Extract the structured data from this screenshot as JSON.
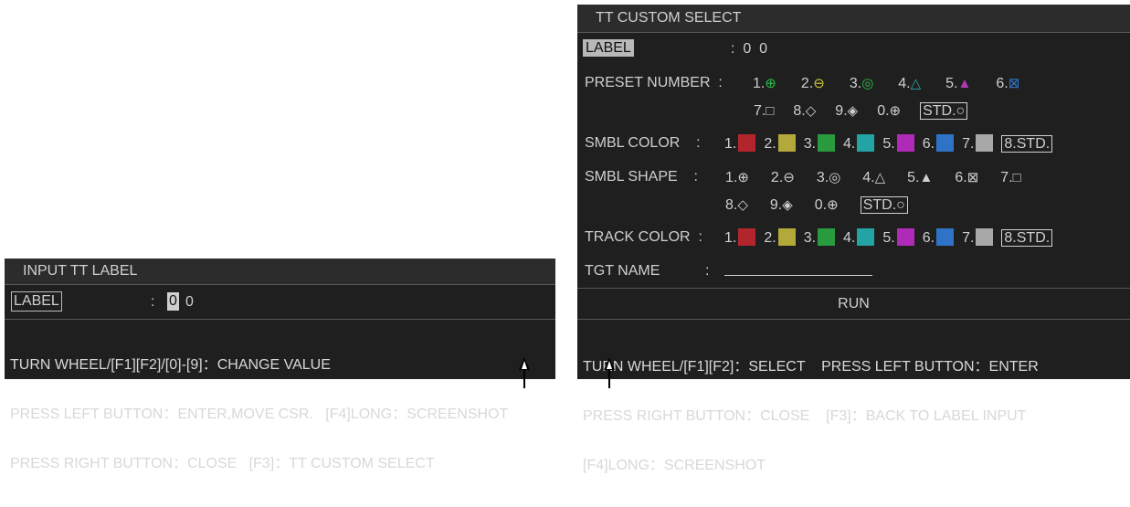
{
  "input_dialog": {
    "title": "INPUT TT LABEL",
    "label_text": "LABEL",
    "colon": ":",
    "digit_cursor": "0",
    "digit_2": "0",
    "help": [
      "TURN WHEEL/[F1][F2]/[0]-[9]：CHANGE VALUE",
      "PRESS LEFT BUTTON：ENTER,MOVE CSR.   [F4]LONG：SCREENSHOT",
      "PRESS RIGHT BUTTON：CLOSE   [F3]：TT CUSTOM SELECT"
    ]
  },
  "custom_dialog": {
    "title": "TT CUSTOM SELECT",
    "label_row": {
      "label": "LABEL",
      "value": ":  0  0"
    },
    "preset_row": {
      "label": "PRESET NUMBER  :",
      "items_line1": [
        {
          "num": "1.",
          "sym": "⊕",
          "color": "#2bbf4a"
        },
        {
          "num": "2.",
          "sym": "⊖",
          "color": "#d1c83a"
        },
        {
          "num": "3.",
          "sym": "◎",
          "color": "#2bbf4a"
        },
        {
          "num": "4.",
          "sym": "△",
          "color": "#2aa6a6"
        },
        {
          "num": "5.",
          "sym": "▲",
          "color": "#b03ab8"
        },
        {
          "num": "6.",
          "sym": "⊠",
          "color": "#2f7ad0"
        }
      ],
      "items_line2": [
        {
          "num": "7.",
          "sym": "□",
          "color": "#cfcfcf"
        },
        {
          "num": "8.",
          "sym": "◇",
          "color": "#cfcfcf"
        },
        {
          "num": "9.",
          "sym": "◈",
          "color": "#cfcfcf"
        },
        {
          "num": "0.",
          "sym": "⊕",
          "color": "#cfcfcf"
        }
      ],
      "std": "STD.○"
    },
    "smbl_color_row": {
      "label": "SMBL COLOR    :",
      "items": [
        {
          "num": "1.",
          "color": "#b3252c"
        },
        {
          "num": "2.",
          "color": "#b3a93a"
        },
        {
          "num": "3.",
          "color": "#2a9a3f"
        },
        {
          "num": "4.",
          "color": "#23a3a3"
        },
        {
          "num": "5.",
          "color": "#b02ab8"
        },
        {
          "num": "6.",
          "color": "#2f73c8"
        },
        {
          "num": "7.",
          "color": "#a8a8a8"
        }
      ],
      "std": "8.STD."
    },
    "smbl_shape_row": {
      "label": "SMBL SHAPE    :",
      "items_line1": [
        {
          "num": "1.",
          "sym": "⊕"
        },
        {
          "num": "2.",
          "sym": "⊖"
        },
        {
          "num": "3.",
          "sym": "◎"
        },
        {
          "num": "4.",
          "sym": "△"
        },
        {
          "num": "5.",
          "sym": "▲"
        },
        {
          "num": "6.",
          "sym": "⊠"
        },
        {
          "num": "7.",
          "sym": "□"
        }
      ],
      "items_line2": [
        {
          "num": "8.",
          "sym": "◇"
        },
        {
          "num": "9.",
          "sym": "◈"
        },
        {
          "num": "0.",
          "sym": "⊕"
        }
      ],
      "std": "STD.○"
    },
    "track_color_row": {
      "label": "TRACK COLOR  :",
      "items": [
        {
          "num": "1.",
          "color": "#b3252c"
        },
        {
          "num": "2.",
          "color": "#b3a93a"
        },
        {
          "num": "3.",
          "color": "#2a9a3f"
        },
        {
          "num": "4.",
          "color": "#23a3a3"
        },
        {
          "num": "5.",
          "color": "#b02ab8"
        },
        {
          "num": "6.",
          "color": "#2f73c8"
        },
        {
          "num": "7.",
          "color": "#a8a8a8"
        }
      ],
      "std": "8.STD."
    },
    "tgt_name": {
      "label": "TGT NAME",
      "colon": ":",
      "value": ""
    },
    "run_label": "RUN",
    "help": [
      "TURN WHEEL/[F1][F2]：SELECT    PRESS LEFT BUTTON：ENTER",
      "PRESS RIGHT BUTTON：CLOSE    [F3]：BACK TO LABEL INPUT",
      "[F4]LONG：SCREENSHOT"
    ]
  }
}
